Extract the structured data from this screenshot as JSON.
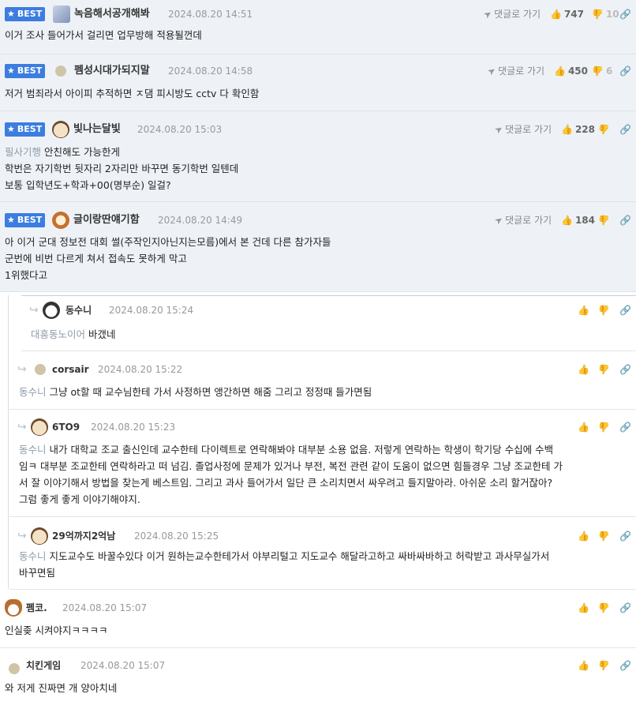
{
  "ui": {
    "best_label": "BEST",
    "goto_label": "댓글로 가기"
  },
  "comments": [
    {
      "nick": "녹음해서공개해봐",
      "date": "2024.08.20 14:51",
      "up": "747",
      "down": "10",
      "best": true,
      "lines": [
        "이거 조사 들어가서 걸리면 업무방해 적용될껀데"
      ]
    },
    {
      "nick": "펨성시대가되지말",
      "date": "2024.08.20 14:58",
      "up": "450",
      "down": "6",
      "best": true,
      "lines": [
        "저거 범죄라서 아이피 추적하면 ㅈ댐 피시방도 cctv 다 확인함"
      ]
    },
    {
      "nick": "빛나는달빛",
      "date": "2024.08.20 15:03",
      "up": "228",
      "down": "",
      "best": true,
      "quote": "필사기행",
      "lines": [
        "안친해도 가능한게",
        "학번은 자기학번 뒷자리 2자리만 바꾸면 동기학번 일텐데",
        "보통 입학년도+학과+00(명부순) 일걸?"
      ]
    },
    {
      "nick": "글이랑딴얘기함",
      "date": "2024.08.20 14:49",
      "up": "184",
      "down": "",
      "best": true,
      "lines": [
        "아 이거 군대 정보전 대회 썰(주작인지아닌지는모름)에서 본 건데 다른 참가자들",
        "군번에 비번 다르게 쳐서 접속도 못하게 막고",
        "1위했다고"
      ]
    },
    {
      "nick": "동수니",
      "date": "2024.08.20 15:24",
      "quote": "대흥동노이어",
      "lines": [
        "바갰네"
      ]
    },
    {
      "nick": "corsair",
      "date": "2024.08.20 15:22",
      "quote": "동수니",
      "lines": [
        "그냥 ot할 때 교수님한테 가서 사정하면 앵간하면 해줌 그리고 정정때 들가면됨"
      ]
    },
    {
      "nick": "6TO9",
      "date": "2024.08.20 15:23",
      "quote": "동수니",
      "lines": [
        "내가 대학교 조교 출신인데 교수한테 다이렉트로 연락해봐야 대부분 소용 없음. 저렇게 연락하는 학생이 학기당 수십에 수백",
        "임ㅋ 대부분 조교한테 연락하라고 떠 넘김. 졸업사정에 문제가 있거나 부전, 복전 관련 같이 도움이 없으면 힘들경우 그냥 조교한테 가",
        "서 잘 이야기해서 방법을 찾는게 베스트임. 그리고 과사 들어가서 일단 큰 소리치면서 싸우려고 들지말아라. 아쉬운 소리 할거잖아?",
        "그럼 좋게 좋게 이야기해야지."
      ]
    },
    {
      "nick": "29억까지2억남",
      "date": "2024.08.20 15:25",
      "quote": "동수니",
      "lines": [
        "지도교수도 바꿀수있다 이거 원하는교수한테가서 야부리털고 지도교수 해달라고하고 싸바싸바하고 허락받고 과사무실가서",
        "바꾸면됨"
      ]
    },
    {
      "nick": "펨코.",
      "date": "2024.08.20 15:07",
      "lines": [
        "인실좆 시켜야지ㅋㅋㅋㅋ"
      ]
    },
    {
      "nick": "치킨게임",
      "date": "2024.08.20 15:07",
      "lines": [
        "와 저게 진짜면 개 양아치네"
      ]
    }
  ]
}
